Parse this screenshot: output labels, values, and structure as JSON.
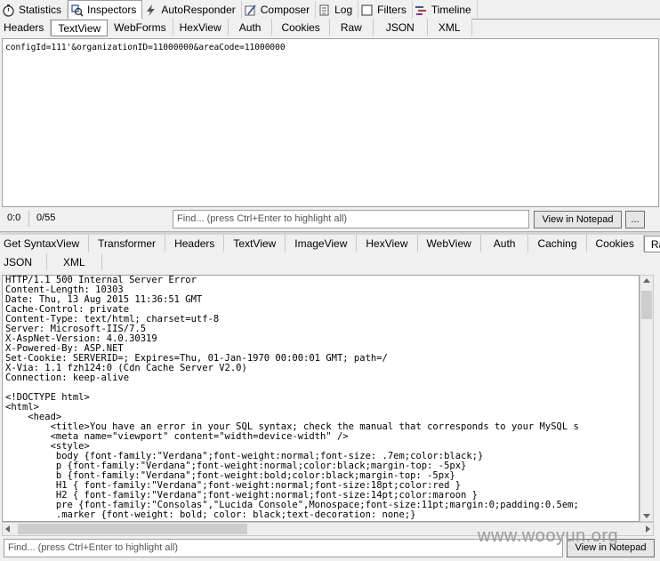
{
  "top_tabs": [
    {
      "label": "Statistics",
      "icon": "stopwatch-icon",
      "active": false
    },
    {
      "label": "Inspectors",
      "icon": "inspector-icon",
      "active": true
    },
    {
      "label": "AutoResponder",
      "icon": "lightning-icon",
      "active": false
    },
    {
      "label": "Composer",
      "icon": "composer-icon",
      "active": false
    },
    {
      "label": "Log",
      "icon": "log-icon",
      "active": false
    },
    {
      "label": "Filters",
      "icon": "checkbox-icon",
      "active": false
    },
    {
      "label": "Timeline",
      "icon": "timeline-icon",
      "active": false
    }
  ],
  "request": {
    "tabs": [
      "Headers",
      "TextView",
      "WebForms",
      "HexView",
      "Auth",
      "Cookies",
      "Raw",
      "JSON",
      "XML"
    ],
    "active_tab": "TextView",
    "body": "configId=111'&organizationID=11000000&areaCode=11000000",
    "status_position": "0:0",
    "status_length": "0/55",
    "find_placeholder": "Find... (press Ctrl+Enter to highlight all)",
    "notepad_label": "View in Notepad",
    "more_label": "..."
  },
  "response": {
    "tabs_row1": [
      "Get SyntaxView",
      "Transformer",
      "Headers",
      "TextView",
      "ImageView",
      "HexView",
      "WebView",
      "Auth",
      "Caching",
      "Cookies",
      "Raw"
    ],
    "tabs_row2": [
      "JSON",
      "XML"
    ],
    "active_tab": "Raw",
    "lines": [
      "HTTP/1.1 500 Internal Server Error",
      "Content-Length: 10303",
      "Date: Thu, 13 Aug 2015 11:36:51 GMT",
      "Cache-Control: private",
      "Content-Type: text/html; charset=utf-8",
      "Server: Microsoft-IIS/7.5",
      "X-AspNet-Version: 4.0.30319",
      "X-Powered-By: ASP.NET",
      "Set-Cookie: SERVERID=; Expires=Thu, 01-Jan-1970 00:00:01 GMT; path=/",
      "X-Via: 1.1 fzh124:0 (Cdn Cache Server V2.0)",
      "Connection: keep-alive",
      "",
      "<!DOCTYPE html>",
      "<html>",
      "    <head>",
      "        <title>You have an error in your SQL syntax; check the manual that corresponds to your MySQL s",
      "        <meta name=\"viewport\" content=\"width=device-width\" />",
      "        <style>",
      "         body {font-family:\"Verdana\";font-weight:normal;font-size: .7em;color:black;}",
      "         p {font-family:\"Verdana\";font-weight:normal;color:black;margin-top: -5px}",
      "         b {font-family:\"Verdana\";font-weight:bold;color:black;margin-top: -5px}",
      "         H1 { font-family:\"Verdana\";font-weight:normal;font-size:18pt;color:red }",
      "         H2 { font-family:\"Verdana\";font-weight:normal;font-size:14pt;color:maroon }",
      "         pre {font-family:\"Consolas\",\"Lucida Console\",Monospace;font-size:11pt;margin:0;padding:0.5em;",
      "         .marker {font-weight: bold; color: black;text-decoration: none;}"
    ],
    "find_placeholder": "Find... (press Ctrl+Enter to highlight all)",
    "notepad_label": "View in Notepad"
  },
  "watermark": "www.wooyun.org"
}
